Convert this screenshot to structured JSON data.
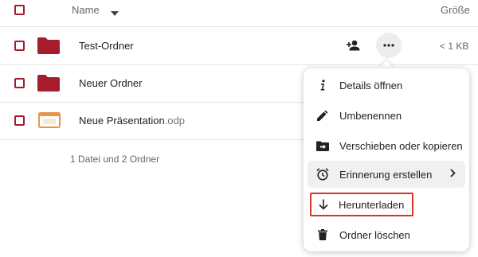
{
  "header": {
    "name_label": "Name",
    "size_label": "Größe"
  },
  "files": [
    {
      "name": "Test-Ordner",
      "ext": "",
      "size": "< 1 KB",
      "type": "folder"
    },
    {
      "name": "Neuer Ordner",
      "ext": "",
      "size": "",
      "type": "folder"
    },
    {
      "name": "Neue Präsentation",
      "ext": ".odp",
      "size": "",
      "type": "presentation"
    }
  ],
  "summary": "1 Datei und 2 Ordner",
  "menu": {
    "items": [
      {
        "label": "Details öffnen",
        "icon": "info-icon"
      },
      {
        "label": "Umbenennen",
        "icon": "pencil-icon"
      },
      {
        "label": "Verschieben oder kopieren",
        "icon": "folder-move-icon"
      },
      {
        "label": "Erinnerung erstellen",
        "icon": "alarm-clock-icon"
      },
      {
        "label": "Herunterladen",
        "icon": "download-icon"
      },
      {
        "label": "Ordner löschen",
        "icon": "trash-icon"
      }
    ]
  },
  "colors": {
    "accent": "#a51d2d",
    "highlight_border": "#d9342b",
    "presentation": "#e8954a"
  }
}
